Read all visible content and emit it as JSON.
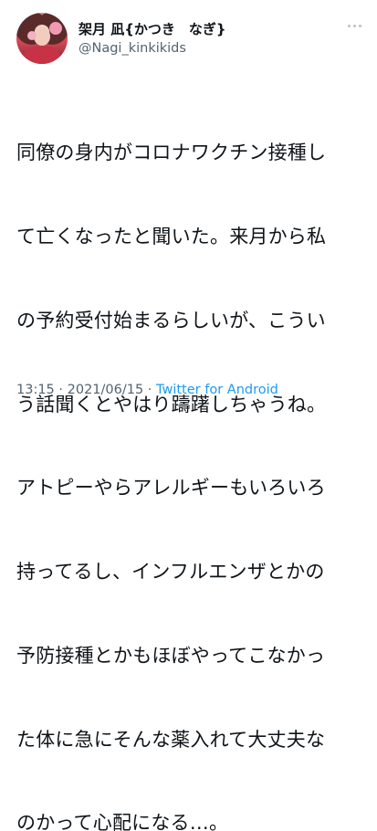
{
  "author": {
    "display_name": "架月 凪{かつき　なぎ}",
    "handle": "@Nagi_kinkikids",
    "avatar_icon": "user-avatar"
  },
  "tweet": {
    "lines": [
      "同僚の身内がコロナワクチン接種し",
      "て亡くなったと聞いた。来月から私",
      "の予約受付始まるらしいが、こうい",
      "う話聞くとやはり躊躇しちゃうね。",
      "アトピーやらアレルギーもいろいろ",
      "持ってるし、インフルエンザとかの",
      "予防接種とかもほぼやってこなかっ",
      "た体に急にそんな薬入れて大丈夫な",
      "のかって心配になる…。"
    ]
  },
  "meta": {
    "time": "13:15",
    "separator1": " · ",
    "date": "2021/06/15",
    "separator2": " · ",
    "source": "Twitter for Android"
  },
  "icons": {
    "more": "more-options-icon"
  },
  "colors": {
    "text": "#0f1419",
    "secondary": "#536471",
    "link": "#1d9bf0"
  }
}
